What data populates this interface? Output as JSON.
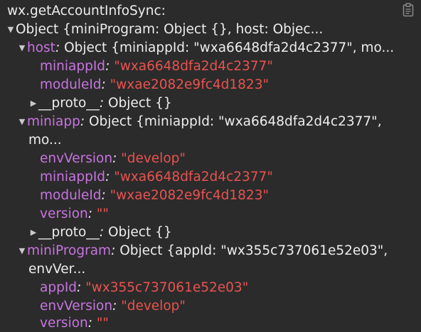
{
  "header": {
    "title": "wx.getAccountInfoSync:"
  },
  "root": {
    "label": "Object {miniProgram: Object {}, host: Objec..."
  },
  "host": {
    "key": "host",
    "summary": "Object {miniappId: \"wxa6648dfa2d4c2377\", mo...",
    "miniappId_key": "miniappId",
    "miniappId_val": "\"wxa6648dfa2d4c2377\"",
    "moduleId_key": "moduleId",
    "moduleId_val": "\"wxae2082e9fc4d1823\"",
    "proto_key": "__proto__",
    "proto_val": "Object {}"
  },
  "miniapp": {
    "key": "miniapp",
    "summary_line1": "Object {miniappId: \"wxa6648dfa2d4c2377\",",
    "summary_line2": "mo...",
    "envVersion_key": "envVersion",
    "envVersion_val": "\"develop\"",
    "miniappId_key": "miniappId",
    "miniappId_val": "\"wxa6648dfa2d4c2377\"",
    "moduleId_key": "moduleId",
    "moduleId_val": "\"wxae2082e9fc4d1823\"",
    "version_key": "version",
    "version_val": "\"\"",
    "proto_key": "__proto__",
    "proto_val": "Object {}"
  },
  "miniProgram": {
    "key": "miniProgram",
    "summary_line1": "Object {appId: \"wx355c737061e52e03\",",
    "summary_line2": "envVer...",
    "appId_key": "appId",
    "appId_val": "\"wx355c737061e52e03\"",
    "envVersion_key": "envVersion",
    "envVersion_val": "\"develop\"",
    "version_key": "version",
    "version_val": "\"\""
  },
  "colors": {
    "background": "#2b2b2b",
    "text": "#ededed",
    "key": "#c874e0",
    "string": "#e8534f"
  },
  "icons": {
    "copy": "clipboard-icon"
  }
}
